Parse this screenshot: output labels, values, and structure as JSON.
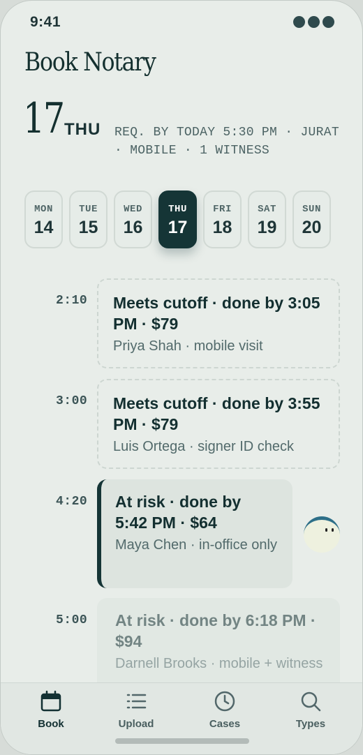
{
  "status": {
    "time": "9:41"
  },
  "header": {
    "title": "Book Notary",
    "day_number": "17",
    "day_name": "THU",
    "requirements": "REQ. BY TODAY 5:30 PM · JURAT · MOBILE · 1 WITNESS"
  },
  "week": [
    {
      "dow": "MON",
      "date": "14",
      "selected": false
    },
    {
      "dow": "TUE",
      "date": "15",
      "selected": false
    },
    {
      "dow": "WED",
      "date": "16",
      "selected": false
    },
    {
      "dow": "THU",
      "date": "17",
      "selected": true
    },
    {
      "dow": "FRI",
      "date": "18",
      "selected": false
    },
    {
      "dow": "SAT",
      "date": "19",
      "selected": false
    },
    {
      "dow": "SUN",
      "date": "20",
      "selected": false
    }
  ],
  "slots": [
    {
      "time": "2:10",
      "status": "meets",
      "headline": "Meets cutoff · done by 3:05 PM · $79",
      "detail": "Priya Shah · mobile visit"
    },
    {
      "time": "3:00",
      "status": "meets",
      "headline": "Meets cutoff · done by 3:55 PM · $79",
      "detail": "Luis Ortega · signer ID check"
    },
    {
      "time": "4:20",
      "status": "at-risk",
      "headline": "At risk · done by 5:42 PM · $64",
      "detail": "Maya Chen · in-office only"
    },
    {
      "time": "5:00",
      "status": "at-risk",
      "headline": "At risk · done by 6:18 PM · $94",
      "detail": "Darnell Brooks · mobile + witness"
    }
  ],
  "tabs": [
    {
      "label": "Book",
      "icon": "calendar-icon",
      "active": true
    },
    {
      "label": "Upload",
      "icon": "list-icon",
      "active": false
    },
    {
      "label": "Cases",
      "icon": "clock-icon",
      "active": false
    },
    {
      "label": "Types",
      "icon": "search-icon",
      "active": false
    }
  ],
  "colors": {
    "accent": "#153536",
    "background": "#e8ede9"
  }
}
